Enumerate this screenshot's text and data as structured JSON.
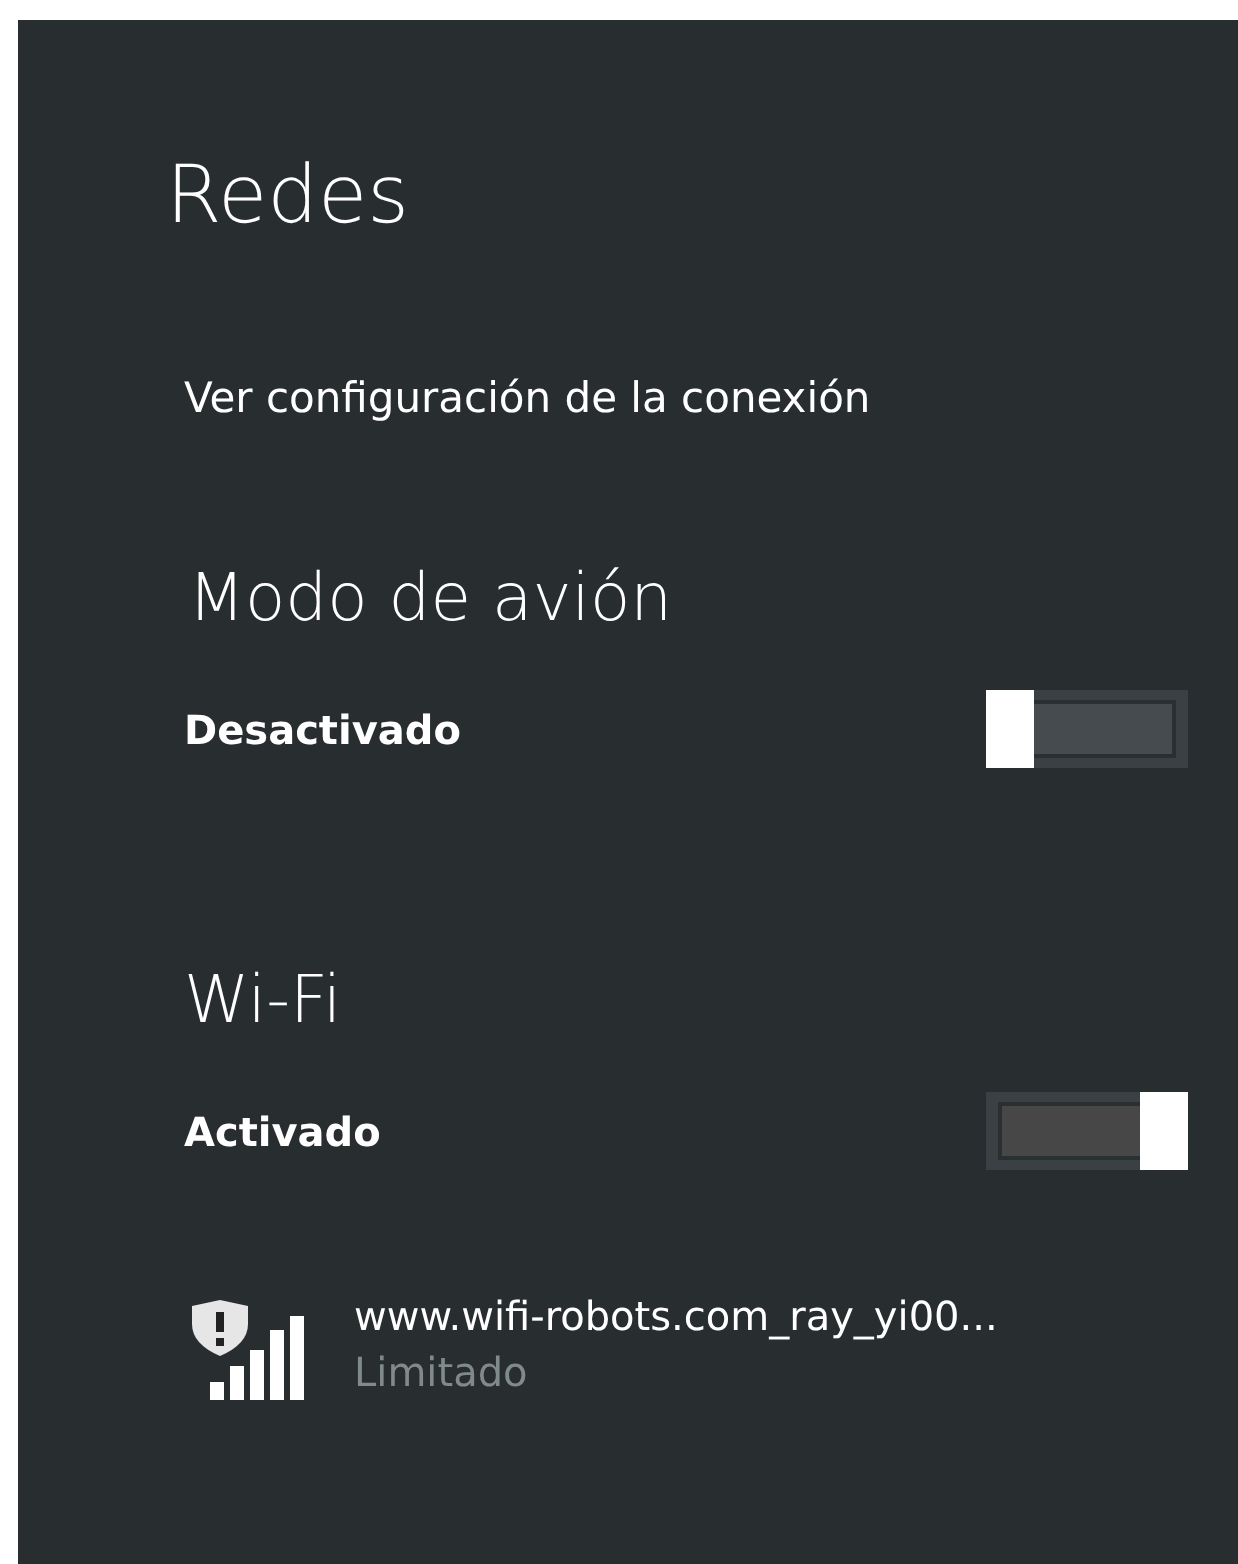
{
  "title": "Redes",
  "settings_link": "Ver configuración de la conexión",
  "sections": [
    {
      "heading": "Modo de avión",
      "state_label": "Desactivado",
      "on": false
    },
    {
      "heading": "Wi-Fi",
      "state_label": "Activado",
      "on": true
    }
  ],
  "networks": [
    {
      "name": "www.wifi-robots.com_ray_yi00...",
      "status": "Limitado",
      "warning": true
    }
  ]
}
